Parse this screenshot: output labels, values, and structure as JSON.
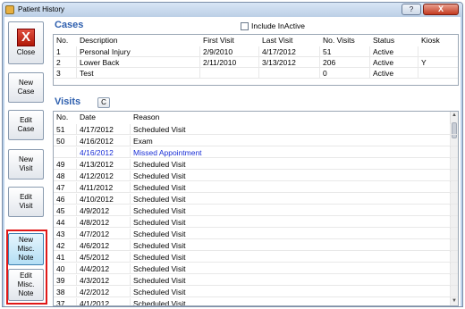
{
  "window": {
    "title": "Patient History",
    "help_label": "?",
    "close_label": "X"
  },
  "sidebar": {
    "close": {
      "icon": "close-x-icon",
      "glyph": "X",
      "label": "Close"
    },
    "buttons": [
      {
        "line1": "New",
        "line2": "Case"
      },
      {
        "line1": "Edit",
        "line2": "Case"
      },
      {
        "line1": "New",
        "line2": "Visit"
      },
      {
        "line1": "Edit",
        "line2": "Visit"
      }
    ],
    "misc_buttons": [
      {
        "line1": "New",
        "line2": "Misc.",
        "line3": "Note"
      },
      {
        "line1": "Edit",
        "line2": "Misc.",
        "line3": "Note"
      }
    ]
  },
  "cases": {
    "title": "Cases",
    "include_inactive_label": "Include InActive",
    "include_inactive_checked": false,
    "columns": [
      "No.",
      "Description",
      "First Visit",
      "Last Visit",
      "No. Visits",
      "Status",
      "Kiosk"
    ],
    "rows": [
      [
        "1",
        "Personal Injury",
        "2/9/2010",
        "4/17/2012",
        "51",
        "Active",
        ""
      ],
      [
        "2",
        "Lower Back",
        "2/11/2010",
        "3/13/2012",
        "206",
        "Active",
        "Y"
      ],
      [
        "3",
        "Test",
        "",
        "",
        "0",
        "Active",
        ""
      ]
    ]
  },
  "visits": {
    "title": "Visits",
    "filter_label": "C",
    "columns": [
      "No.",
      "Date",
      "Reason"
    ],
    "rows": [
      [
        "51",
        "4/17/2012",
        "Scheduled Visit"
      ],
      [
        "50",
        "4/16/2012",
        "Exam"
      ],
      [
        "",
        "4/16/2012",
        "Missed Appointment"
      ],
      [
        "49",
        "4/13/2012",
        "Scheduled Visit"
      ],
      [
        "48",
        "4/12/2012",
        "Scheduled Visit"
      ],
      [
        "47",
        "4/11/2012",
        "Scheduled Visit"
      ],
      [
        "46",
        "4/10/2012",
        "Scheduled Visit"
      ],
      [
        "45",
        "4/9/2012",
        "Scheduled Visit"
      ],
      [
        "44",
        "4/8/2012",
        "Scheduled Visit"
      ],
      [
        "43",
        "4/7/2012",
        "Scheduled Visit"
      ],
      [
        "42",
        "4/6/2012",
        "Scheduled Visit"
      ],
      [
        "41",
        "4/5/2012",
        "Scheduled Visit"
      ],
      [
        "40",
        "4/4/2012",
        "Scheduled Visit"
      ],
      [
        "39",
        "4/3/2012",
        "Scheduled Visit"
      ],
      [
        "38",
        "4/2/2012",
        "Scheduled Visit"
      ],
      [
        "37",
        "4/1/2012",
        "Scheduled Visit"
      ]
    ],
    "missed_row_index": 2,
    "missed_color": "#1a2fd6"
  },
  "colors": {
    "section_title": "#2e5fae",
    "highlight_box": "#e01818",
    "window_close": "#c43a20"
  }
}
